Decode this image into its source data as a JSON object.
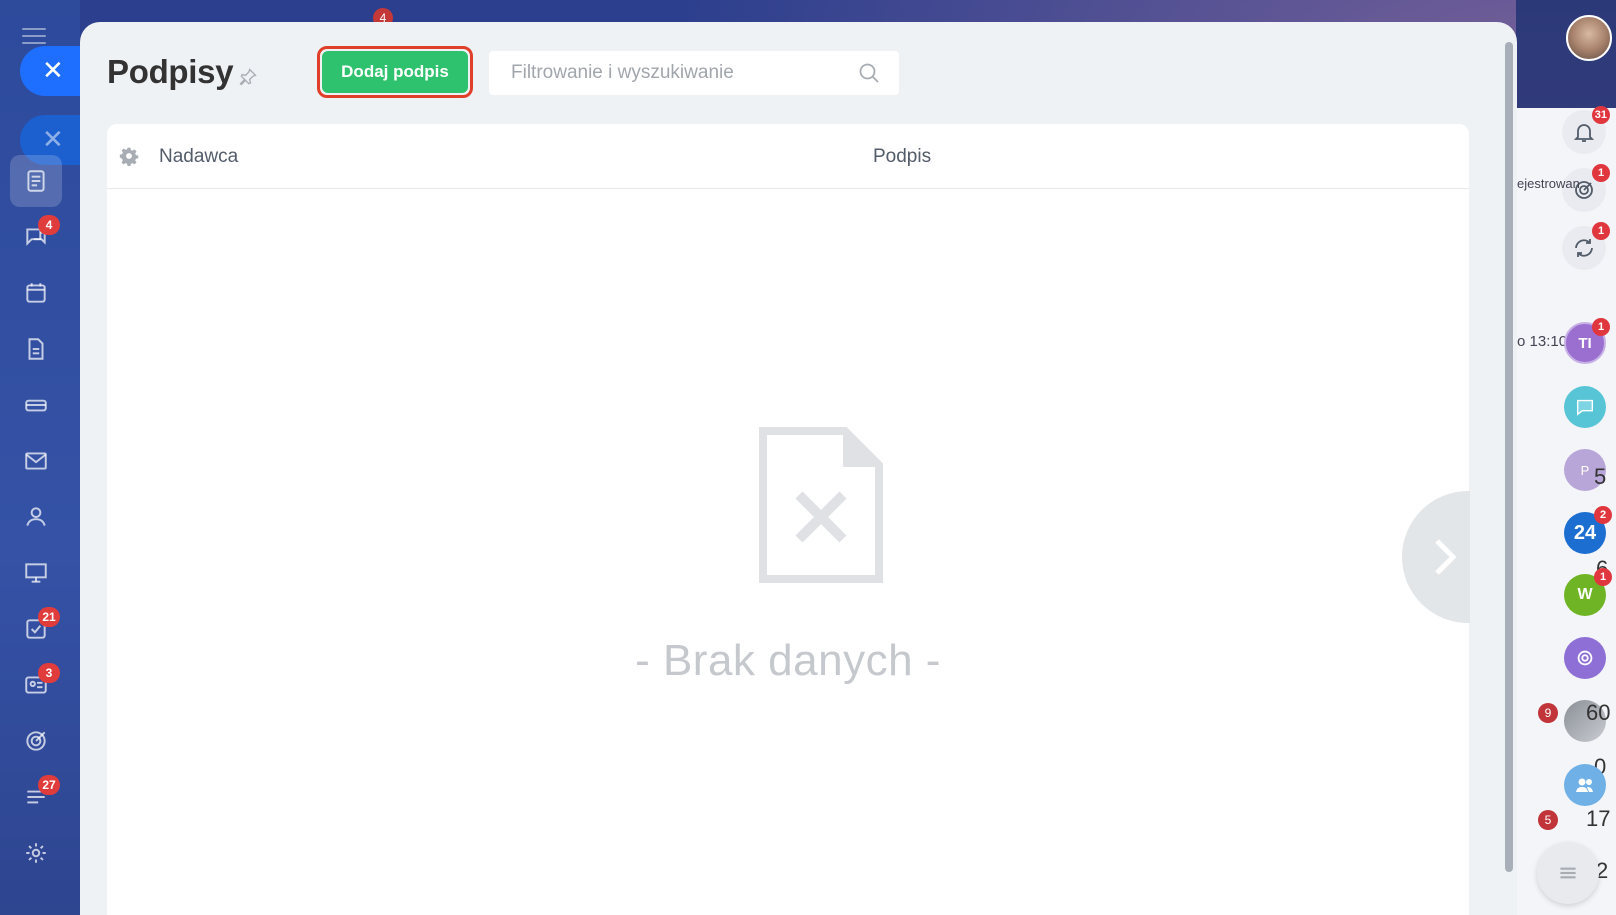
{
  "page": {
    "title": "Podpisy",
    "add_button_label": "Dodaj podpis",
    "search_placeholder": "Filtrowanie i wyszukiwanie"
  },
  "grid": {
    "columns": [
      "Nadawca",
      "Podpis"
    ],
    "empty_text": "- Brak danych -"
  },
  "left_sidebar": {
    "top_badge": "4",
    "items": [
      {
        "icon": "feed-icon",
        "badge": ""
      },
      {
        "icon": "chat-icon",
        "badge": "4"
      },
      {
        "icon": "calendar-icon",
        "badge": ""
      },
      {
        "icon": "document-icon",
        "badge": ""
      },
      {
        "icon": "drive-icon",
        "badge": ""
      },
      {
        "icon": "mail-icon",
        "badge": ""
      },
      {
        "icon": "users-icon",
        "badge": ""
      },
      {
        "icon": "presentation-icon",
        "badge": ""
      },
      {
        "icon": "tasks-icon",
        "badge": "21"
      },
      {
        "icon": "crm-icon",
        "badge": "3"
      },
      {
        "icon": "target-icon",
        "badge": ""
      },
      {
        "icon": "workflow-icon",
        "badge": "27"
      },
      {
        "icon": "settings-icon",
        "badge": ""
      }
    ]
  },
  "right_panel": {
    "notifications_badge": "31",
    "activity_badge": "1",
    "sync_badge": "1",
    "avatar_ti_label": "TI",
    "avatar_ti_badge": "1",
    "avatar_p_label": "P",
    "avatar_24_label": "24",
    "avatar_24_badge": "2",
    "avatar_w_label": "W",
    "avatar_w_badge": "1",
    "bg_text_registered": "ejestrowan",
    "bg_text_time": "o 13:10",
    "num_5": "5",
    "num_6": "6",
    "num_60": "60",
    "num_0": "0",
    "num_17": "17",
    "num_2": "2",
    "red_9": "9",
    "red_5": "5"
  },
  "colors": {
    "accent_green": "#2fc26e",
    "highlight_red": "#e0402a",
    "close_blue": "#1e6fff",
    "badge_red": "#e0373f"
  }
}
